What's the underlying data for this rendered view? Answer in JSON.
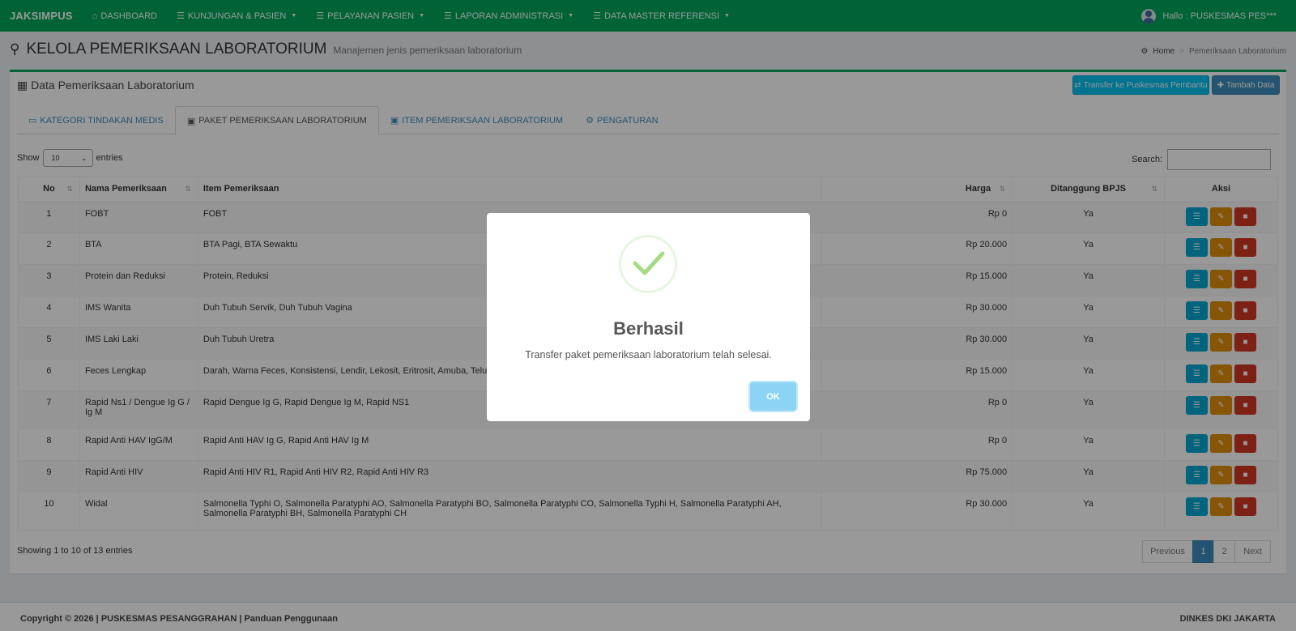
{
  "nav": {
    "brand": "JAKSIMPUS",
    "items": [
      {
        "label": "DASHBOARD",
        "icon": "home-icon"
      },
      {
        "label": "KUNJUNGAN & PASIEN",
        "icon": "list-icon"
      },
      {
        "label": "PELAYANAN PASIEN",
        "icon": "list-icon"
      },
      {
        "label": "LAPORAN ADMINISTRASI",
        "icon": "list-icon"
      },
      {
        "label": "DATA MASTER REFERENSI",
        "icon": "list-icon"
      }
    ],
    "user": "Hallo : PUSKESMAS PES***"
  },
  "header": {
    "title": "KELOLA PEMERIKSAAN LABORATORIUM",
    "subtitle": "Manajemen jenis pemeriksaan laboratorium",
    "breadcrumb": {
      "home": "Home",
      "current": "Pemeriksaan Laboratorium"
    }
  },
  "box": {
    "title": "Data Pemeriksaan Laboratorium",
    "transfer_label": "Transfer ke Puskesmas Pembantu",
    "add_label": "Tambah Data"
  },
  "tabs": [
    {
      "label": "KATEGORI TINDAKAN MEDIS",
      "icon": "laptop-icon"
    },
    {
      "label": "PAKET PEMERIKSAAN LABORATORIUM",
      "icon": "medkit-icon"
    },
    {
      "label": "ITEM PEMERIKSAAN LABORATORIUM",
      "icon": "medkit-icon"
    },
    {
      "label": "PENGATURAN",
      "icon": "gear-icon"
    }
  ],
  "table_controls": {
    "show_label": "Show",
    "show_value": "10",
    "entries_label": "entries",
    "search_label": "Search:",
    "search_value": ""
  },
  "table": {
    "columns": [
      "No",
      "Nama Pemeriksaan",
      "Item Pemeriksaan",
      "Harga",
      "Ditanggung BPJS",
      "Aksi"
    ],
    "rows": [
      {
        "no": "1",
        "nama": "FOBT",
        "item": "FOBT",
        "harga": "Rp 0",
        "bpjs": "Ya"
      },
      {
        "no": "2",
        "nama": "BTA",
        "item": "BTA Pagi, BTA Sewaktu",
        "harga": "Rp 20.000",
        "bpjs": "Ya"
      },
      {
        "no": "3",
        "nama": "Protein dan Reduksi",
        "item": "Protein, Reduksi",
        "harga": "Rp 15.000",
        "bpjs": "Ya"
      },
      {
        "no": "4",
        "nama": "IMS Wanita",
        "item": "Duh Tubuh Servik, Duh Tubuh Vagina",
        "harga": "Rp 30.000",
        "bpjs": "Ya"
      },
      {
        "no": "5",
        "nama": "IMS Laki Laki",
        "item": "Duh Tubuh Uretra",
        "harga": "Rp 30.000",
        "bpjs": "Ya"
      },
      {
        "no": "6",
        "nama": "Feces Lengkap",
        "item": "Darah, Warna Feces, Konsistensi, Lendir, Lekosit, Eritrosit, Amuba, Telur",
        "harga": "Rp 15.000",
        "bpjs": "Ya"
      },
      {
        "no": "7",
        "nama": "Rapid Ns1 / Dengue Ig G / Ig M",
        "item": "Rapid Dengue Ig G, Rapid Dengue Ig M, Rapid NS1",
        "harga": "Rp 0",
        "bpjs": "Ya"
      },
      {
        "no": "8",
        "nama": "Rapid Anti HAV IgG/M",
        "item": "Rapid Anti HAV Ig G, Rapid Anti HAV Ig M",
        "harga": "Rp 0",
        "bpjs": "Ya"
      },
      {
        "no": "9",
        "nama": "Rapid Anti HIV",
        "item": "Rapid Anti HIV R1, Rapid Anti HIV R2, Rapid Anti HIV R3",
        "harga": "Rp 75.000",
        "bpjs": "Ya"
      },
      {
        "no": "10",
        "nama": "Widal",
        "item": "Salmonella Typhi O, Salmonella Paratyphi AO, Salmonella Paratyphi BO, Salmonella Paratyphi CO, Salmonella Typhi H, Salmonella Paratyphi AH, Salmonella Paratyphi BH, Salmonella Paratyphi CH",
        "harga": "Rp 30.000",
        "bpjs": "Ya"
      }
    ]
  },
  "pagination": {
    "info": "Showing 1 to 10 of 13 entries",
    "previous": "Previous",
    "pages": [
      "1",
      "2"
    ],
    "next": "Next"
  },
  "footer": {
    "left": "Copyright © 2026 | PUSKESMAS PESANGGRAHAN | Panduan Penggunaan",
    "right": "DINKES DKI JAKARTA"
  },
  "modal": {
    "title": "Berhasil",
    "text": "Transfer paket pemeriksaan laboratorium telah selesai.",
    "ok_label": "OK"
  },
  "colors": {
    "brand_green": "#00a65a",
    "primary": "#3c8dbc",
    "info": "#00c0ef",
    "warning": "#e08e0b",
    "danger": "#d33724",
    "success_check": "#a5dc86",
    "ok_button": "#8cd4f5"
  }
}
